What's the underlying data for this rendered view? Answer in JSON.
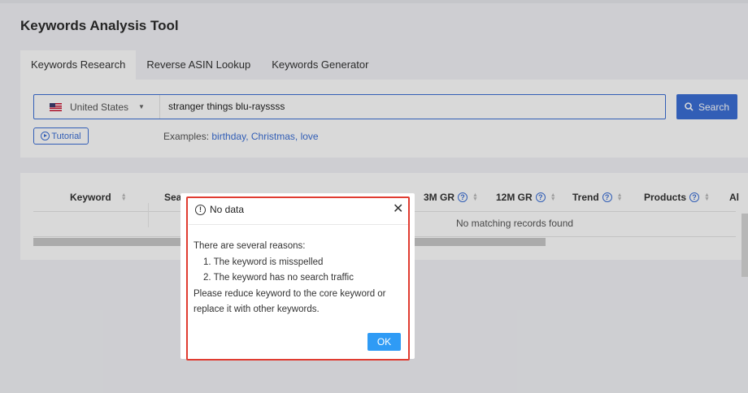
{
  "page": {
    "title": "Keywords Analysis Tool"
  },
  "tabs": [
    {
      "label": "Keywords Research",
      "active": true
    },
    {
      "label": "Reverse ASIN Lookup",
      "active": false
    },
    {
      "label": "Keywords Generator",
      "active": false
    }
  ],
  "search": {
    "country": "United States",
    "country_flag_icon": "us-flag-icon",
    "keyword_value": "stranger things blu-rayssss",
    "button_label": "Search",
    "tutorial_label": "Tutorial",
    "examples_prefix": "Examples:",
    "examples": [
      "birthday",
      "Christmas",
      "love"
    ]
  },
  "table": {
    "columns": [
      "Keyword",
      "Sea",
      "3M GR",
      "12M GR",
      "Trend",
      "Products",
      "Al"
    ],
    "empty_text": "No matching records found"
  },
  "modal": {
    "title": "No data",
    "lines": [
      "There are several reasons:",
      "1. The keyword is misspelled",
      "2. The keyword has no search traffic",
      "Please reduce keyword to the core keyword or",
      "replace it with other keywords."
    ],
    "ok_label": "OK"
  },
  "colors": {
    "accent": "#3b6fd6",
    "ok_button": "#2f9bf5",
    "highlight": "#e03c31"
  }
}
